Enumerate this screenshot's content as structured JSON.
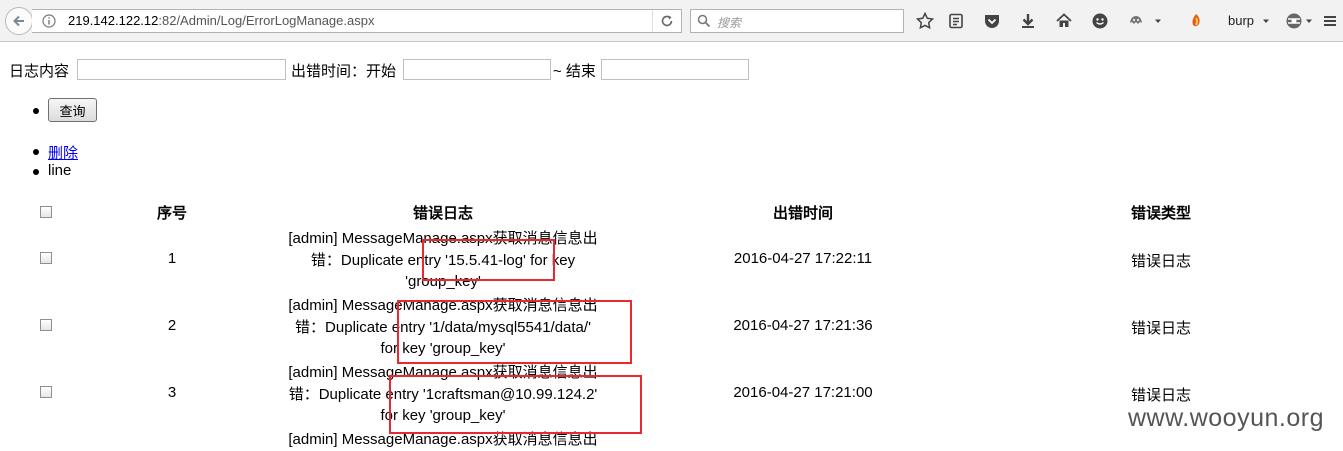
{
  "browser": {
    "url_host": "219.142.122.12",
    "url_rest": ":82/Admin/Log/ErrorLogManage.aspx",
    "search_placeholder": "搜索",
    "profile_label": "burp"
  },
  "filters": {
    "content_label": "日志内容",
    "time_label": "出错时间：开始",
    "end_label": "~ 结束"
  },
  "actions": {
    "query_label": "查询",
    "delete_label": "删除",
    "line_label": "line"
  },
  "table": {
    "headers": [
      "序号",
      "错误日志",
      "出错时间",
      "错误类型"
    ],
    "rows": [
      {
        "index": "1",
        "log_lines": [
          "[admin] MessageManage.aspx获取消息信息出",
          "错：Duplicate entry '15.5.41-log' for key",
          "'group_key'"
        ],
        "time": "2016-04-27 17:22:11",
        "type": "错误日志"
      },
      {
        "index": "2",
        "log_lines": [
          "[admin] MessageManage.aspx获取消息信息出",
          "错：Duplicate entry '1/data/mysql5541/data/'",
          "for key 'group_key'"
        ],
        "time": "2016-04-27 17:21:36",
        "type": "错误日志"
      },
      {
        "index": "3",
        "log_lines": [
          "[admin] MessageManage.aspx获取消息信息出",
          "错：Duplicate entry '1craftsman@10.99.124.2'",
          "for key 'group_key'"
        ],
        "time": "2016-04-27 17:21:00",
        "type": "错误日志"
      },
      {
        "log_lines": [
          "[admin] MessageManage.aspx获取消息信息出"
        ]
      }
    ]
  },
  "watermark": "www.wooyun.org",
  "colors": {
    "highlight": "#e8292f",
    "link": "#0000ee"
  }
}
